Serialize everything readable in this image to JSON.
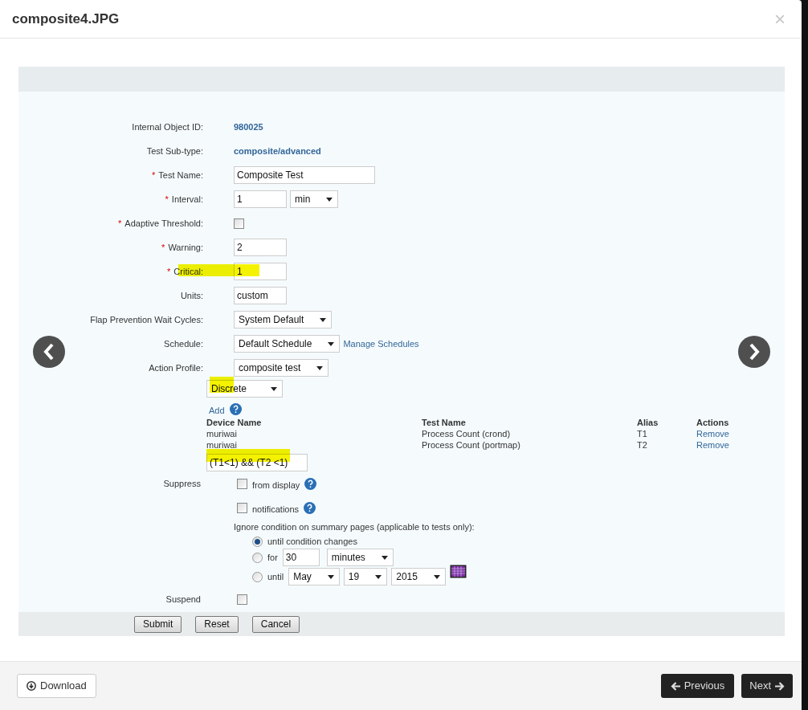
{
  "dialog": {
    "title": "composite4.JPG",
    "close": "×"
  },
  "form": {
    "required_mark": "*",
    "fields": [
      {
        "label": "Internal Object ID:",
        "required": false,
        "controls": [
          {
            "kind": "text",
            "value": "980025"
          }
        ]
      },
      {
        "label": "Test Sub-type:",
        "required": false,
        "controls": [
          {
            "kind": "text",
            "value": "composite/advanced"
          }
        ]
      },
      {
        "label": "Test Name:",
        "required": true,
        "controls": [
          {
            "kind": "input",
            "value": "Composite Test"
          }
        ]
      },
      {
        "label": "Interval:",
        "required": true,
        "controls": [
          {
            "kind": "input",
            "value": "1"
          },
          {
            "kind": "select",
            "value": "min"
          }
        ]
      },
      {
        "label": "Adaptive Threshold:",
        "required": true,
        "controls": [
          {
            "kind": "checkbox",
            "checked": false
          }
        ]
      },
      {
        "label": "Warning:",
        "required": true,
        "controls": [
          {
            "kind": "input",
            "value": "2"
          }
        ]
      },
      {
        "label": "Critical:",
        "required": true,
        "controls": [
          {
            "kind": "input",
            "value": "1"
          }
        ]
      },
      {
        "label": "Units:",
        "required": false,
        "controls": [
          {
            "kind": "input",
            "value": "custom"
          }
        ]
      },
      {
        "label": "Flap Prevention Wait Cycles:",
        "required": false,
        "controls": [
          {
            "kind": "select",
            "value": "System Default"
          }
        ]
      },
      {
        "label": "Schedule:",
        "required": false,
        "controls": [
          {
            "kind": "select",
            "value": "Default Schedule"
          },
          {
            "kind": "link",
            "value": "Manage Schedules"
          }
        ]
      },
      {
        "label": "Action Profile:",
        "required": false,
        "controls": [
          {
            "kind": "select",
            "value": "composite test"
          }
        ]
      }
    ],
    "composite": {
      "mode": "Discrete",
      "add": "Add",
      "columns": [
        "Device Name",
        "Test Name",
        "Alias",
        "Actions"
      ],
      "rows": [
        {
          "device": "muriwai",
          "test": "Process Count (crond)",
          "alias": "T1",
          "action": "Remove"
        },
        {
          "device": "muriwai",
          "test": "Process Count (portmap)",
          "alias": "T2",
          "action": "Remove"
        }
      ],
      "expression": "(T1<1) && (T2 <1)"
    },
    "suppress": {
      "label": "Suppress",
      "options": [
        {
          "label": "from display",
          "checked": false
        },
        {
          "label": "notifications",
          "checked": false
        }
      ],
      "ignore_text": "Ignore condition on summary pages (applicable to tests only):",
      "choices": [
        {
          "kind": "plain",
          "label": "until condition changes",
          "selected": true
        },
        {
          "kind": "duration",
          "label": "for",
          "selected": false,
          "value": "30",
          "unit": "minutes"
        },
        {
          "kind": "date",
          "label": "until",
          "selected": false,
          "month": "May",
          "day": "19",
          "year": "2015"
        }
      ]
    },
    "suspend": {
      "label": "Suspend",
      "checked": false
    },
    "buttons": [
      "Submit",
      "Reset",
      "Cancel"
    ]
  },
  "footer": {
    "download": "Download",
    "previous": "Previous",
    "next": "Next"
  }
}
